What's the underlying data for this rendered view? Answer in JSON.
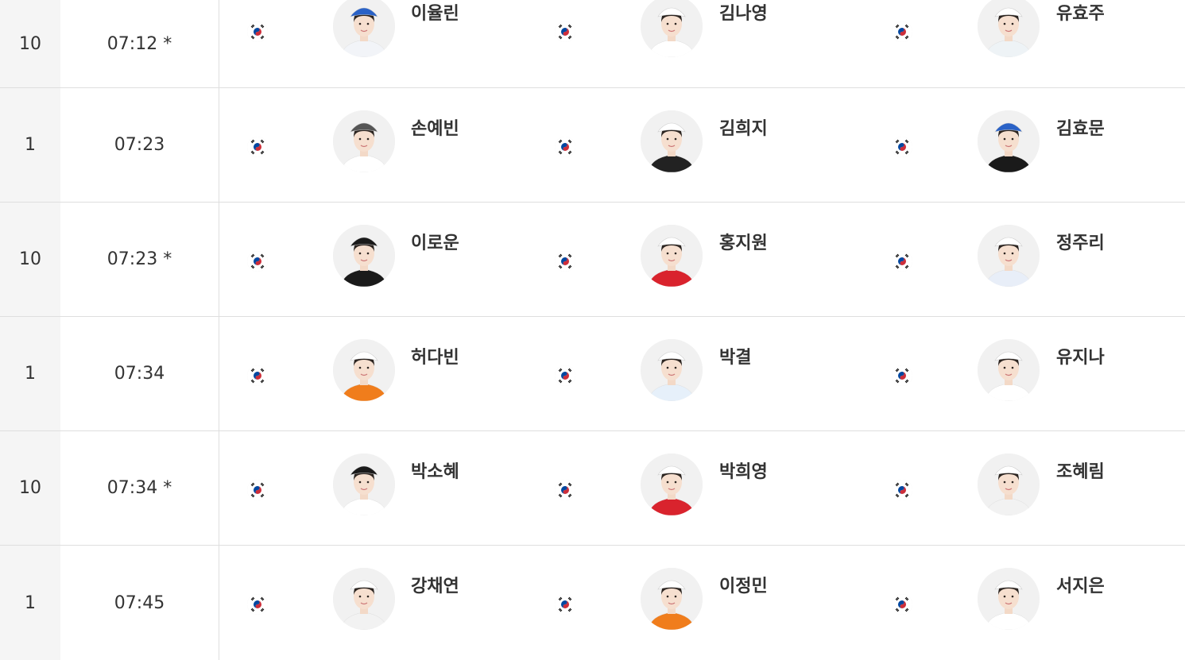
{
  "rows": [
    {
      "tee": "10",
      "time": "07:12 *",
      "players": [
        {
          "name": "이율린",
          "cap": "#2a62c7",
          "shirt": "#f2f4f8",
          "flag": "korea-flag-icon"
        },
        {
          "name": "김나영",
          "cap": "#ffffff",
          "shirt": "#ffffff",
          "flag": "korea-flag-icon"
        },
        {
          "name": "유효주",
          "cap": "#ffffff",
          "shirt": "#eef3f6",
          "flag": "korea-flag-icon"
        }
      ]
    },
    {
      "tee": "1",
      "time": "07:23",
      "players": [
        {
          "name": "손예빈",
          "cap": "#555555",
          "shirt": "#ffffff",
          "flag": "korea-flag-icon"
        },
        {
          "name": "김희지",
          "cap": "#ffffff",
          "shirt": "#222222",
          "flag": "korea-flag-icon"
        },
        {
          "name": "김효문",
          "cap": "#2a62c7",
          "shirt": "#1a1a1a",
          "flag": "korea-flag-icon"
        }
      ]
    },
    {
      "tee": "10",
      "time": "07:23 *",
      "players": [
        {
          "name": "이로운",
          "cap": "#1a1a1a",
          "shirt": "#1a1a1a",
          "flag": "korea-flag-icon"
        },
        {
          "name": "홍지원",
          "cap": "#ffffff",
          "shirt": "#d9232d",
          "flag": "korea-flag-icon"
        },
        {
          "name": "정주리",
          "cap": "#ffffff",
          "shirt": "#e8eef8",
          "flag": "korea-flag-icon"
        }
      ]
    },
    {
      "tee": "1",
      "time": "07:34",
      "players": [
        {
          "name": "허다빈",
          "cap": "#ffffff",
          "shirt": "#f07d1c",
          "flag": "korea-flag-icon"
        },
        {
          "name": "박결",
          "cap": "#ffffff",
          "shirt": "#e6f0fa",
          "flag": "korea-flag-icon"
        },
        {
          "name": "유지나",
          "cap": "#ffffff",
          "shirt": "#ffffff",
          "flag": "korea-flag-icon"
        }
      ]
    },
    {
      "tee": "10",
      "time": "07:34 *",
      "players": [
        {
          "name": "박소혜",
          "cap": "#1a1a1a",
          "shirt": "#ffffff",
          "flag": "korea-flag-icon"
        },
        {
          "name": "박희영",
          "cap": "#ffffff",
          "shirt": "#d9232d",
          "flag": "korea-flag-icon"
        },
        {
          "name": "조혜림",
          "cap": "#ffffff",
          "shirt": "#f2f2f2",
          "flag": "korea-flag-icon"
        }
      ]
    },
    {
      "tee": "1",
      "time": "07:45",
      "players": [
        {
          "name": "강채연",
          "cap": "#ffffff",
          "shirt": "#f2f2f2",
          "flag": "korea-flag-icon"
        },
        {
          "name": "이정민",
          "cap": "#ffffff",
          "shirt": "#f07d1c",
          "flag": "korea-flag-icon"
        },
        {
          "name": "서지은",
          "cap": "#ffffff",
          "shirt": "#ffffff",
          "flag": "korea-flag-icon"
        }
      ]
    }
  ]
}
